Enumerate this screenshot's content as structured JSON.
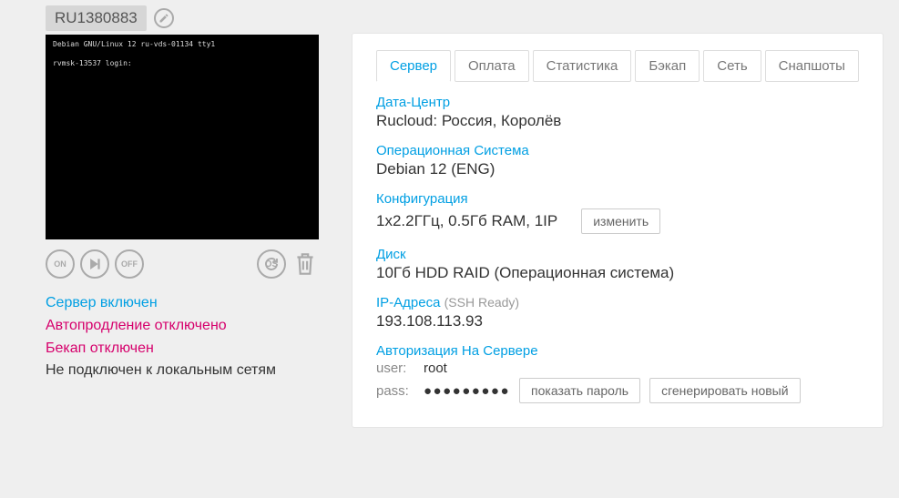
{
  "server_id": "RU1380883",
  "console": {
    "line1": "Debian GNU/Linux 12 ru-vds-01134 tty1",
    "line2": "rvmsk-13537 login:"
  },
  "status": {
    "server_on": "Сервер включен",
    "autorenew_off": "Автопродление отключено",
    "backup_off": "Бекап отключен",
    "no_lan": "Не подключен к локальным сетям"
  },
  "tabs": {
    "server": "Сервер",
    "payment": "Оплата",
    "stats": "Статистика",
    "backup": "Бэкап",
    "network": "Сеть",
    "snapshots": "Снапшоты"
  },
  "details": {
    "dc_label": "Дата-Центр",
    "dc_value": "Rucloud: Россия, Королёв",
    "os_label": "Операционная Система",
    "os_value": "Debian 12 (ENG)",
    "config_label": "Конфигурация",
    "config_value": "1x2.2ГГц, 0.5Гб RAM, 1IP",
    "config_change": "изменить",
    "disk_label": "Диск",
    "disk_value": "10Гб HDD RAID (Операционная система)",
    "ip_label": "IP-Адреса",
    "ip_ready": "(SSH Ready)",
    "ip_value": "193.108.113.93",
    "auth_label": "Авторизация На Сервере",
    "auth_user_label": "user:",
    "auth_user_value": "root",
    "auth_pass_label": "pass:",
    "auth_pass_value": "●●●●●●●●●",
    "show_password": "показать пароль",
    "generate_new": "сгенерировать новый"
  },
  "action_labels": {
    "on": "ON",
    "off": "OFF",
    "os": "OS"
  }
}
